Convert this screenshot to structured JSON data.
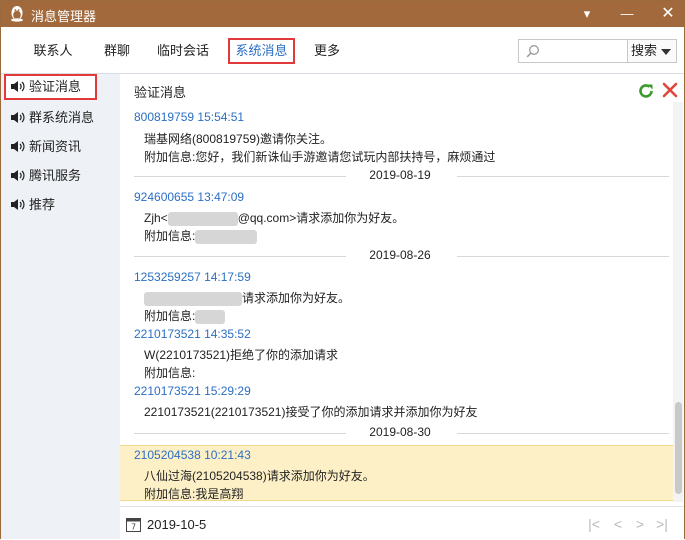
{
  "window": {
    "title": "消息管理器",
    "menu_glyph": "▾",
    "minimize_glyph": "—",
    "close_glyph": "✕"
  },
  "tabs": [
    {
      "label": "联系人"
    },
    {
      "label": "群聊"
    },
    {
      "label": "临时会话"
    },
    {
      "label": "系统消息"
    },
    {
      "label": "更多"
    }
  ],
  "search": {
    "placeholder": "",
    "button_label": "搜索"
  },
  "sidebar": {
    "items": [
      {
        "label": "验证消息"
      },
      {
        "label": "群系统消息"
      },
      {
        "label": "新闻资讯"
      },
      {
        "label": "腾讯服务"
      },
      {
        "label": "推荐"
      }
    ]
  },
  "main": {
    "heading": "验证消息",
    "messages": {
      "m1_header": "800819759 15:54:51",
      "m1_line1": "瑞基网络(800819759)邀请你关注。",
      "m1_line2": "附加信息:您好，我们新诛仙手游邀请您试玩内部扶持号，麻烦通过",
      "date1": "2019-08-19",
      "m2_header": "924600655 13:47:09",
      "m2_line1_a": "Zjh<",
      "m2_line1_b": "@qq.com>请求添加你为好友。",
      "m2_line2": "附加信息:",
      "date2": "2019-08-26",
      "m3_header": "1253259257 14:17:59",
      "m3_line1": "请求添加你为好友。",
      "m3_line2": "附加信息:",
      "m4_header": "2210173521 14:35:52",
      "m4_line1": "W(2210173521)拒绝了你的添加请求",
      "m4_line2": "附加信息:",
      "m5_header": "2210173521 15:29:29",
      "m5_line1": "2210173521(2210173521)接受了你的添加请求并添加你为好友",
      "date3": "2019-08-30",
      "m6_header": "2105204538 10:21:43",
      "m6_line1": "八仙过海(2105204538)请求添加你为好友。",
      "m6_line2": "附加信息:我是高翔"
    }
  },
  "bottom": {
    "date": "2019-10-5",
    "first_glyph": "|<",
    "prev_glyph": "<",
    "next_glyph": ">",
    "last_glyph": ">|"
  },
  "colors": {
    "titlebar": "#a26a3c",
    "accent": "#2b6fc4",
    "highlight": "#fdf0c6",
    "annotation_red": "#e23a3a"
  }
}
